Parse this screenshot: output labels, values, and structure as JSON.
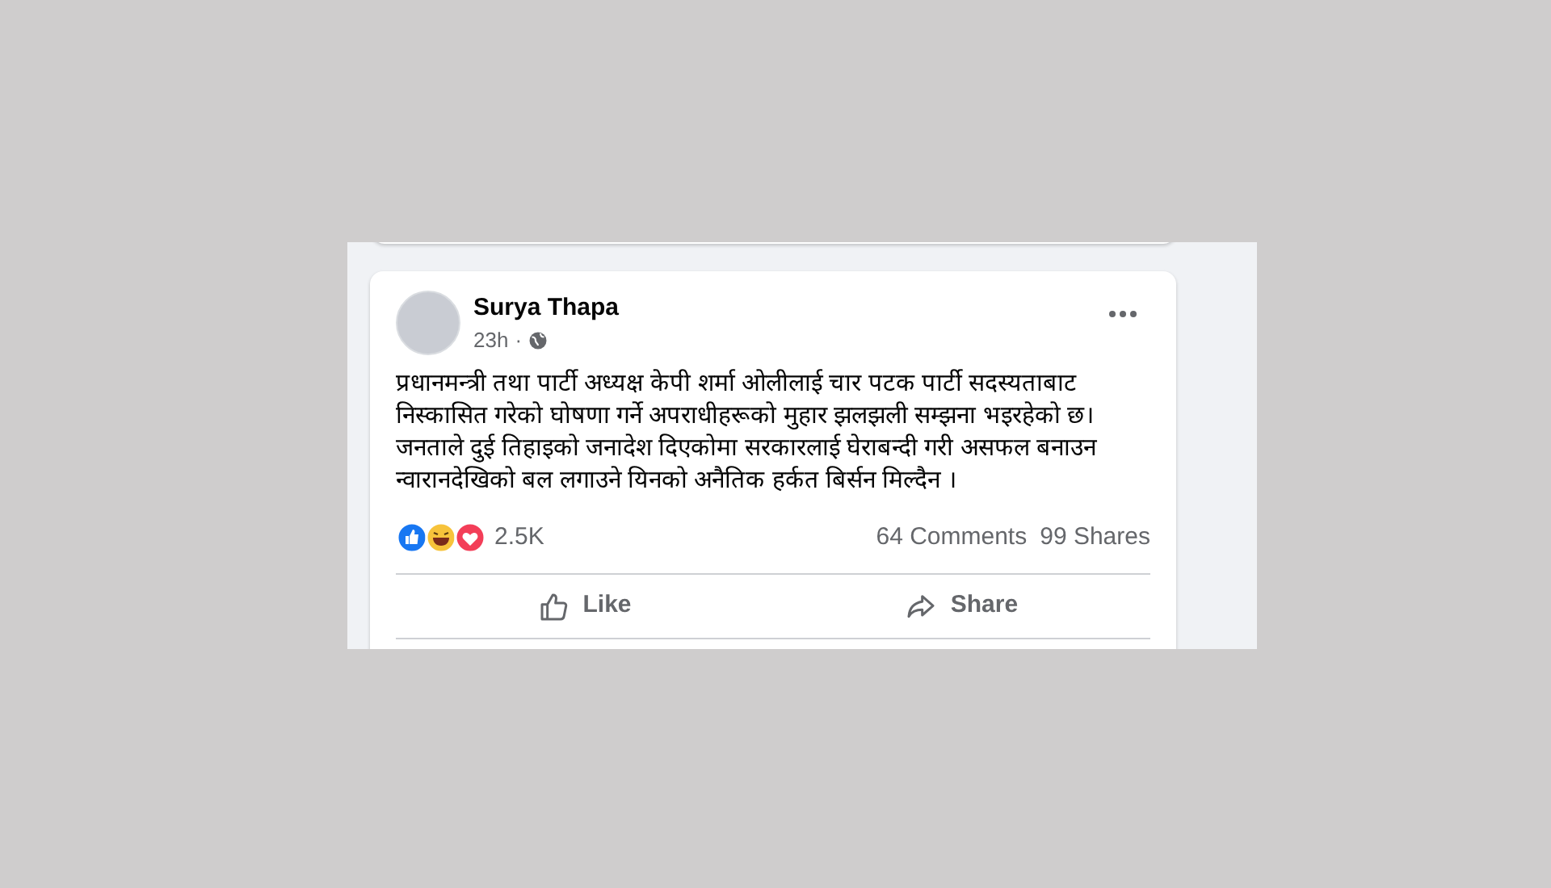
{
  "post": {
    "author": "Surya Thapa",
    "time": "23h",
    "separator": "·",
    "text": "प्रधानमन्त्री तथा पार्टी अध्यक्ष केपी शर्मा ओलीलाई चार पटक पार्टी सदस्यताबाट निस्कासित गरेको घोषणा गर्ने अपराधीहरूको मुहार झलझली सम्झना भइरहेको छ। जनताले दुई तिहाइको जनादेश दिएकोमा सरकारलाई घेराबन्दी गरी असफल बनाउन न्वारानदेखिको बल लगाउने यिनको अनैतिक हर्कत बिर्सन मिल्दैन ।",
    "reactions_count": "2.5K",
    "comments": "64 Comments",
    "shares": "99 Shares",
    "actions": [
      {
        "kind": "like",
        "label": "Like"
      },
      {
        "kind": "share",
        "label": "Share"
      }
    ]
  }
}
